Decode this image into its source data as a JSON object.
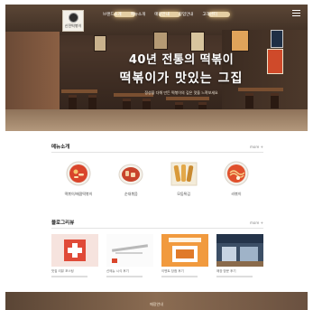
{
  "brand": {
    "logo_text": "신전떡볶이"
  },
  "nav": {
    "items": [
      "브랜드소개",
      "메뉴소개",
      "매장안내",
      "창업안내",
      "고객센터"
    ]
  },
  "hero": {
    "headline_line1": "40년 전통의 떡볶이",
    "headline_line2": "떡볶이가 맛있는 그집",
    "subtitle": "정성을 다해 만든 떡볶이의 깊은 맛을 느껴보세요"
  },
  "menu_section": {
    "title": "메뉴소개",
    "more": "more +",
    "items": [
      {
        "name": "떡볶이/매콤떡볶이",
        "icon": "tteokbokki-plate-icon"
      },
      {
        "name": "순대볶음",
        "icon": "sundae-plate-icon"
      },
      {
        "name": "모둠튀김",
        "icon": "fried-platter-icon"
      },
      {
        "name": "라볶이",
        "icon": "rabokki-bowl-icon"
      }
    ]
  },
  "blog_section": {
    "title": "블로그리뷰",
    "more": "more +",
    "cards": [
      {
        "caption": "맛집 리뷰 포스팅"
      },
      {
        "caption": "신메뉴 시식 후기"
      },
      {
        "caption": "이벤트 당첨 후기"
      },
      {
        "caption": "매장 방문 후기"
      }
    ]
  },
  "banner": {
    "label": "매장안내"
  },
  "colors": {
    "accent_red": "#d9452b",
    "wood_dark": "#3a2b22",
    "text_dark": "#222222"
  }
}
